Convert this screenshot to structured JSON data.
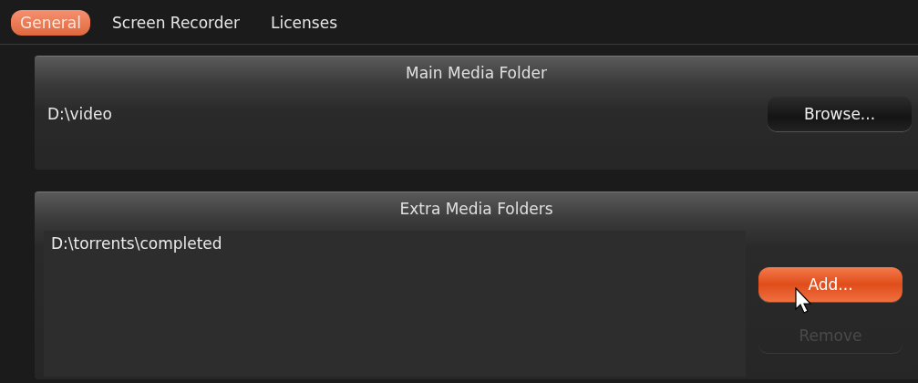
{
  "tabs": [
    {
      "label": "General",
      "selected": true
    },
    {
      "label": "Screen Recorder",
      "selected": false
    },
    {
      "label": "Licenses",
      "selected": false
    }
  ],
  "main_media_folder": {
    "title": "Main Media Folder",
    "path": "D:\\video",
    "browse_button": "Browse..."
  },
  "extra_media_folders": {
    "title": "Extra Media Folders",
    "folders": [
      "D:\\torrents\\completed"
    ],
    "add_button": "Add...",
    "remove_button": {
      "label": "Remove",
      "disabled": true
    }
  }
}
